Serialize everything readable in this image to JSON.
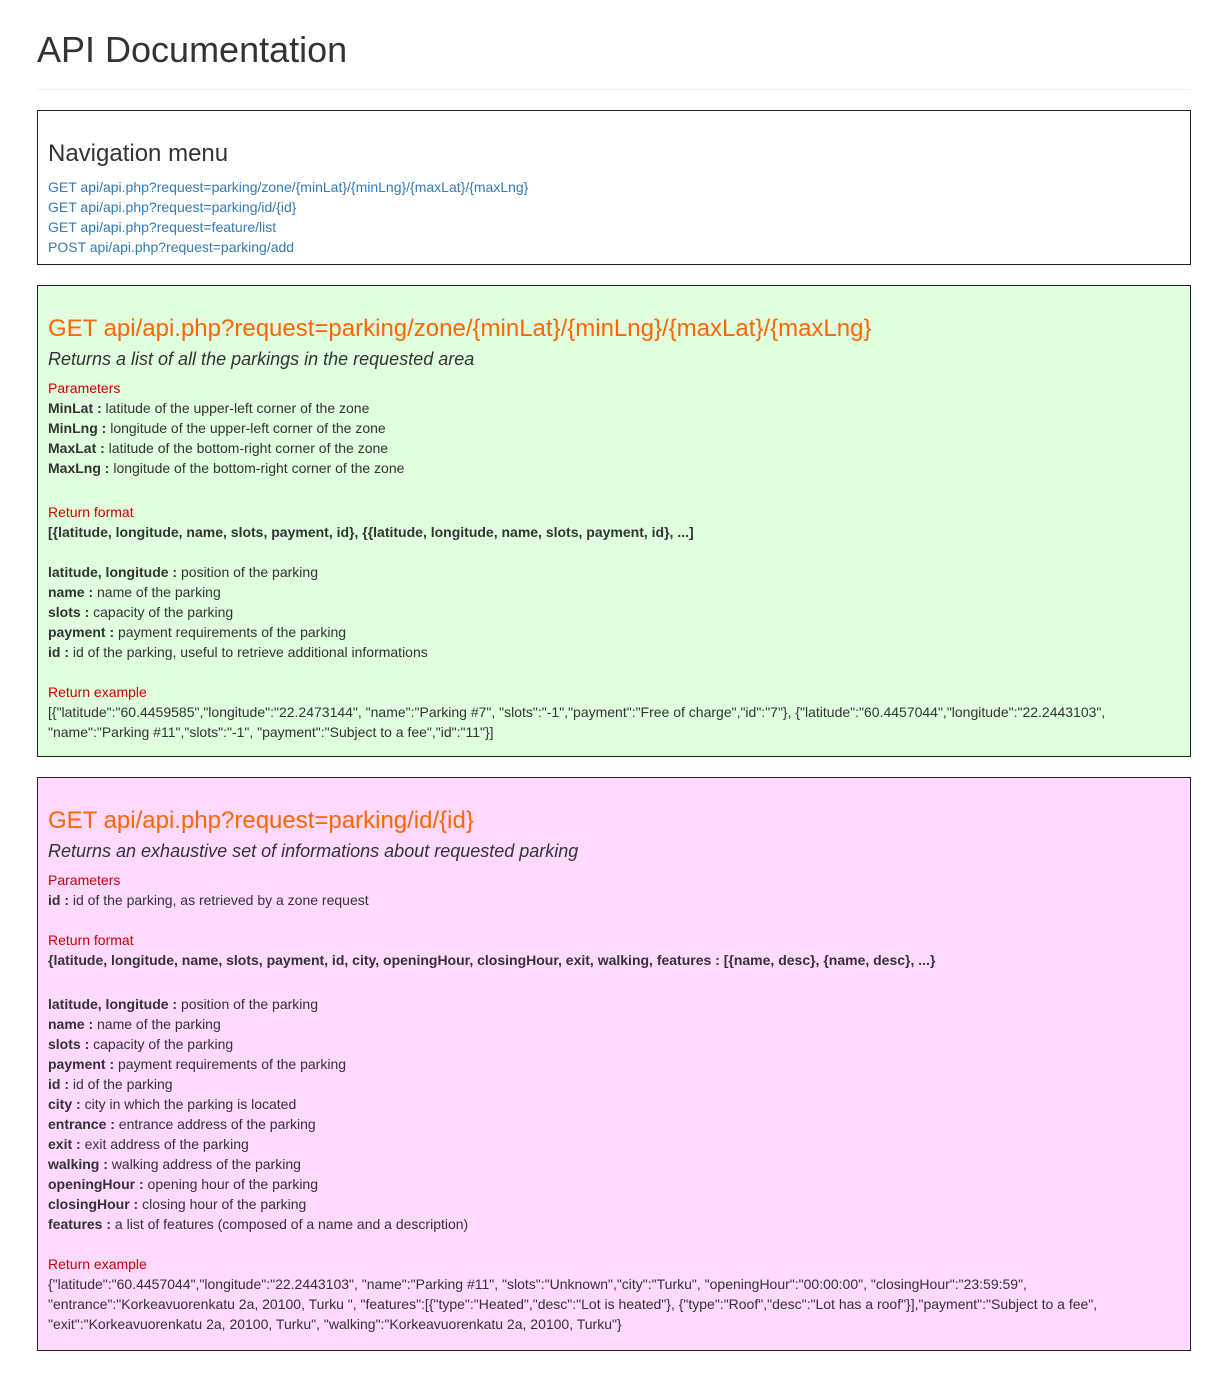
{
  "page": {
    "title": "API Documentation"
  },
  "nav": {
    "heading": "Navigation menu",
    "links": [
      "GET api/api.php?request=parking/zone/{minLat}/{minLng}/{maxLat}/{maxLng}",
      "GET api/api.php?request=parking/id/{id}",
      "GET api/api.php?request=feature/list",
      "POST api/api.php?request=parking/add"
    ]
  },
  "zone": {
    "title": "GET api/api.php?request=parking/zone/{minLat}/{minLng}/{maxLat}/{maxLng}",
    "description": "Returns a list of all the parkings in the requested area",
    "params_label": "Parameters",
    "params": [
      {
        "name": "MinLat :",
        "desc": " latitude of the upper-left corner of the zone"
      },
      {
        "name": "MinLng :",
        "desc": " longitude of the upper-left corner of the zone"
      },
      {
        "name": "MaxLat :",
        "desc": " latitude of the bottom-right corner of the zone"
      },
      {
        "name": "MaxLng :",
        "desc": " longitude of the bottom-right corner of the zone"
      }
    ],
    "format_label": "Return format",
    "format": "[{latitude, longitude, name, slots, payment, id}, {{latitude, longitude, name, slots, payment, id}, ...]",
    "fields": [
      {
        "name": "latitude, longitude :",
        "desc": " position of the parking"
      },
      {
        "name": "name :",
        "desc": " name of the parking"
      },
      {
        "name": "slots :",
        "desc": " capacity of the parking"
      },
      {
        "name": "payment :",
        "desc": " payment requirements of the parking"
      },
      {
        "name": "id :",
        "desc": " id of the parking, useful to retrieve additional informations"
      }
    ],
    "example_label": "Return example",
    "example_lines": [
      "[{\"latitude\":\"60.4459585\",\"longitude\":\"22.2473144\", \"name\":\"Parking #7\", \"slots\":\"-1\",\"payment\":\"Free of charge\",\"id\":\"7\"}, {\"latitude\":\"60.4457044\",\"longitude\":\"22.2443103\",",
      "\"name\":\"Parking #11\",\"slots\":\"-1\", \"payment\":\"Subject to a fee\",\"id\":\"11\"}]"
    ]
  },
  "byid": {
    "title": "GET api/api.php?request=parking/id/{id}",
    "description": "Returns an exhaustive set of informations about requested parking",
    "params_label": "Parameters",
    "params": [
      {
        "name": "id :",
        "desc": " id of the parking, as retrieved by a zone request"
      }
    ],
    "format_label": "Return format",
    "format": "{latitude, longitude, name, slots, payment, id, city, openingHour, closingHour, exit, walking, features : [{name, desc}, {name, desc}, ...}",
    "fields": [
      {
        "name": "latitude, longitude :",
        "desc": " position of the parking"
      },
      {
        "name": "name :",
        "desc": " name of the parking"
      },
      {
        "name": "slots :",
        "desc": " capacity of the parking"
      },
      {
        "name": "payment :",
        "desc": " payment requirements of the parking"
      },
      {
        "name": "id :",
        "desc": " id of the parking"
      },
      {
        "name": "city :",
        "desc": " city in which the parking is located"
      },
      {
        "name": "entrance :",
        "desc": " entrance address of the parking"
      },
      {
        "name": "exit :",
        "desc": " exit address of the parking"
      },
      {
        "name": "walking :",
        "desc": " walking address of the parking"
      },
      {
        "name": "openingHour :",
        "desc": " opening hour of the parking"
      },
      {
        "name": "closingHour :",
        "desc": " closing hour of the parking"
      },
      {
        "name": "features :",
        "desc": " a list of features (composed of a name and a description)"
      }
    ],
    "example_label": "Return example",
    "example_lines": [
      "{\"latitude\":\"60.4457044\",\"longitude\":\"22.2443103\", \"name\":\"Parking #11\", \"slots\":\"Unknown\",\"city\":\"Turku\", \"openingHour\":\"00:00:00\", \"closingHour\":\"23:59:59\",",
      "\"entrance\":\"Korkeavuorenkatu 2a, 20100, Turku \", \"features\":[{\"type\":\"Heated\",\"desc\":\"Lot is heated\"}, {\"type\":\"Roof\",\"desc\":\"Lot has a roof\"}],\"payment\":\"Subject to a fee\",",
      "\"exit\":\"Korkeavuorenkatu 2a, 20100, Turku\", \"walking\":\"Korkeavuorenkatu 2a, 20100, Turku\"}"
    ]
  }
}
